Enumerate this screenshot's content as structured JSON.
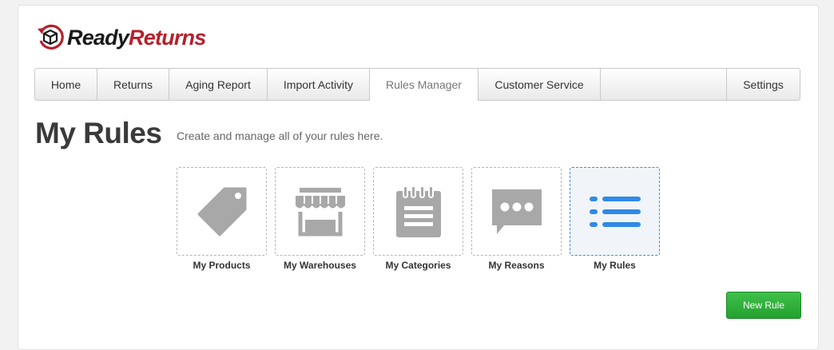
{
  "brand": {
    "part1": "Ready",
    "part2": "Returns",
    "accent_color": "#b5202c"
  },
  "nav": {
    "items": [
      {
        "label": "Home"
      },
      {
        "label": "Returns"
      },
      {
        "label": "Aging Report"
      },
      {
        "label": "Import Activity"
      },
      {
        "label": "Rules Manager",
        "active": true
      },
      {
        "label": "Customer Service"
      }
    ],
    "settings_label": "Settings"
  },
  "page": {
    "title": "My Rules",
    "subtitle": "Create and manage all of your rules here."
  },
  "tiles": [
    {
      "label": "My Products",
      "icon": "tag-icon"
    },
    {
      "label": "My Warehouses",
      "icon": "storefront-icon"
    },
    {
      "label": "My Categories",
      "icon": "notepad-icon"
    },
    {
      "label": "My Reasons",
      "icon": "chat-bubble-icon"
    },
    {
      "label": "My Rules",
      "icon": "list-icon",
      "active": true
    }
  ],
  "actions": {
    "new_rule_label": "New Rule",
    "button_color": "#2bb038"
  },
  "colors": {
    "active_tile_border": "#3c8ed8",
    "icon_gray": "#a8a8a8",
    "icon_blue": "#2f8ae6"
  }
}
